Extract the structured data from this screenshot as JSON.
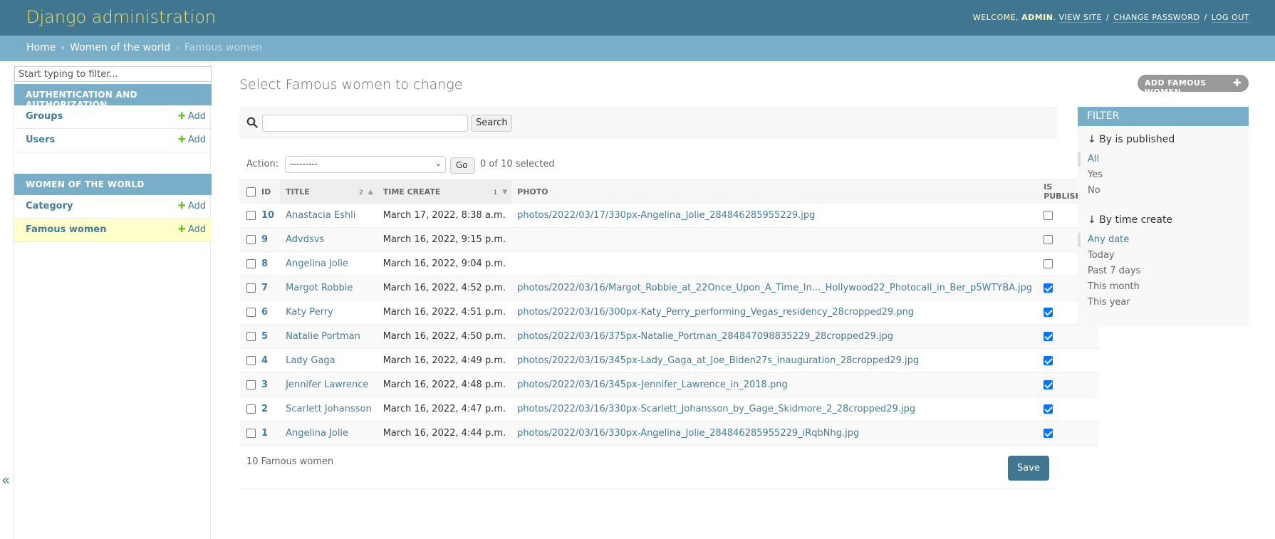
{
  "header": {
    "title": "Django administration",
    "welcome": "WELCOME,",
    "username": "ADMIN",
    "view_site": "VIEW SITE",
    "change_password": "CHANGE PASSWORD",
    "log_out": "LOG OUT"
  },
  "breadcrumbs": {
    "home": "Home",
    "app": "Women of the world",
    "current": "Famous women"
  },
  "sidebar": {
    "filter_placeholder": "Start typing to filter...",
    "apps": [
      {
        "caption": "AUTHENTICATION AND AUTHORIZATION",
        "models": [
          {
            "name": "Groups",
            "add": "Add"
          },
          {
            "name": "Users",
            "add": "Add"
          }
        ]
      },
      {
        "caption": "WOMEN OF THE WORLD",
        "models": [
          {
            "name": "Category",
            "add": "Add"
          },
          {
            "name": "Famous women",
            "add": "Add"
          }
        ]
      }
    ],
    "collapse_glyph": "«"
  },
  "content": {
    "title": "Select Famous women to change",
    "add_button": "ADD FAMOUS WOMEN",
    "search_button": "Search",
    "action_label": "Action:",
    "action_selected": "---------",
    "go_button": "Go",
    "selected_count": "0 of 10 selected",
    "columns": {
      "id": "ID",
      "title": "TITLE",
      "title_sort_priority": "2",
      "time_create": "TIME CREATE",
      "time_sort_priority": "1",
      "photo": "PHOTO",
      "is_published": "IS PUBLISHED"
    },
    "rows": [
      {
        "id": "10",
        "title": "Anastacia Eshli",
        "time": "March 17, 2022, 8:38 a.m.",
        "photo": "photos/2022/03/17/330px-Angelina_Jolie_284846285955229.jpg",
        "published": false
      },
      {
        "id": "9",
        "title": "Advdsvs",
        "time": "March 16, 2022, 9:15 p.m.",
        "photo": "",
        "published": false
      },
      {
        "id": "8",
        "title": "Angelina Jolie",
        "time": "March 16, 2022, 9:04 p.m.",
        "photo": "",
        "published": false
      },
      {
        "id": "7",
        "title": "Margot Robbie",
        "time": "March 16, 2022, 4:52 p.m.",
        "photo": "photos/2022/03/16/Margot_Robbie_at_22Once_Upon_A_Time_In..._Hollywood22_Photocall_in_Ber_p5WTYBA.jpg",
        "published": true
      },
      {
        "id": "6",
        "title": "Katy Perry",
        "time": "March 16, 2022, 4:51 p.m.",
        "photo": "photos/2022/03/16/300px-Katy_Perry_performing_Vegas_residency_28cropped29.png",
        "published": true
      },
      {
        "id": "5",
        "title": "Natalie Portman",
        "time": "March 16, 2022, 4:50 p.m.",
        "photo": "photos/2022/03/16/375px-Natalie_Portman_284847098835229_28cropped29.jpg",
        "published": true
      },
      {
        "id": "4",
        "title": "Lady Gaga",
        "time": "March 16, 2022, 4:49 p.m.",
        "photo": "photos/2022/03/16/345px-Lady_Gaga_at_Joe_Biden27s_inauguration_28cropped29.jpg",
        "published": true
      },
      {
        "id": "3",
        "title": "Jennifer Lawrence",
        "time": "March 16, 2022, 4:48 p.m.",
        "photo": "photos/2022/03/16/345px-Jennifer_Lawrence_in_2018.png",
        "published": true
      },
      {
        "id": "2",
        "title": "Scarlett Johansson",
        "time": "March 16, 2022, 4:47 p.m.",
        "photo": "photos/2022/03/16/330px-Scarlett_Johansson_by_Gage_Skidmore_2_28cropped29.jpg",
        "published": true
      },
      {
        "id": "1",
        "title": "Angelina Jolie",
        "time": "March 16, 2022, 4:44 p.m.",
        "photo": "photos/2022/03/16/330px-Angelina_Jolie_284846285955229_iRqbNhg.jpg",
        "published": true
      }
    ],
    "result_count": "10 Famous women",
    "save_button": "Save"
  },
  "filter": {
    "title": "FILTER",
    "groups": [
      {
        "heading": "↓ By is published",
        "options": [
          "All",
          "Yes",
          "No"
        ],
        "selected": "All"
      },
      {
        "heading": "↓ By time create",
        "options": [
          "Any date",
          "Today",
          "Past 7 days",
          "This month",
          "This year"
        ],
        "selected": "Any date"
      }
    ]
  },
  "colors": {
    "header": "#417690",
    "breadcrumbs": "#79aec8",
    "brand_text": "#f5dd5d",
    "link": "#447e9b",
    "current_model_bg": "#ffffcc",
    "add_plus": "#70bf2b",
    "checkbox_checked": "#0075ff"
  }
}
